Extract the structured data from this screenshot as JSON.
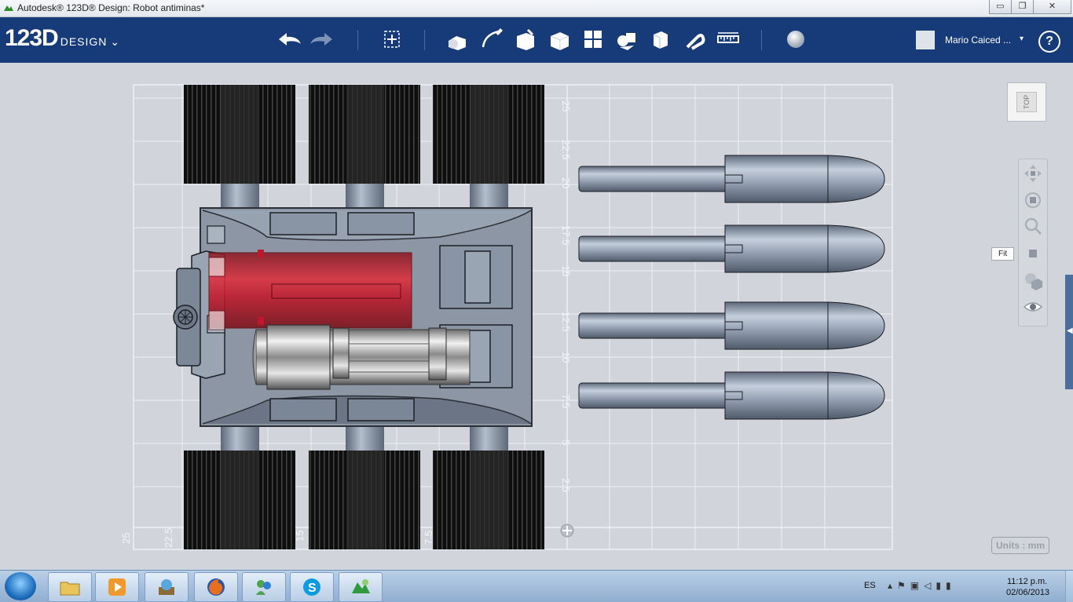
{
  "window": {
    "title": "Autodesk® 123D® Design: Robot antiminas*",
    "minimize_glyph": "▭",
    "maximize_glyph": "❐",
    "close_glyph": "✕"
  },
  "toolbar": {
    "logo_main": "123D",
    "logo_sub": "DESIGN",
    "logo_caret": "⌄",
    "tools": [
      {
        "icon": "undo-icon"
      },
      {
        "icon": "redo-icon"
      },
      {
        "icon": "transform-icon"
      },
      {
        "icon": "primitives-icon"
      },
      {
        "icon": "sketch-icon"
      },
      {
        "icon": "construct-icon"
      },
      {
        "icon": "modify-icon"
      },
      {
        "icon": "pattern-icon"
      },
      {
        "icon": "grouping-icon"
      },
      {
        "icon": "combine-icon"
      },
      {
        "icon": "snap-icon"
      },
      {
        "icon": "measure-icon"
      },
      {
        "icon": "material-icon"
      }
    ],
    "user_name": "Mario Caiced ...",
    "user_caret": "▾",
    "help": "?"
  },
  "viewport": {
    "viewcube_label": "TOP",
    "fit_tooltip": "Fit",
    "units_label": "Units : mm",
    "axis_right_labels": [
      "25",
      "22.5",
      "20",
      "17.5",
      "15",
      "12.5",
      "10",
      "7.5",
      "5",
      "2.5"
    ],
    "axis_bottom_labels": [
      "25",
      "22.5",
      "15",
      "7.5"
    ],
    "nav_tools": [
      "pan-icon",
      "orbit-icon",
      "zoom-icon",
      "fit-icon",
      "view-mode-icon",
      "visibility-icon"
    ]
  },
  "taskbar": {
    "apps": [
      "explorer-icon",
      "media-player-icon",
      "desktop-gadget-icon",
      "firefox-icon",
      "messenger-icon",
      "skype-icon",
      "123d-design-icon"
    ],
    "language": "ES",
    "time": "11:12 p.m.",
    "date": "02/06/2013"
  },
  "colors": {
    "toolbar_bg": "#173a78",
    "viewport_bg": "#d1d5db",
    "robot_body": "#8c96a4",
    "wheel": "#111111",
    "red_part": "#c0182a",
    "bullet": "#8e9bb0"
  }
}
